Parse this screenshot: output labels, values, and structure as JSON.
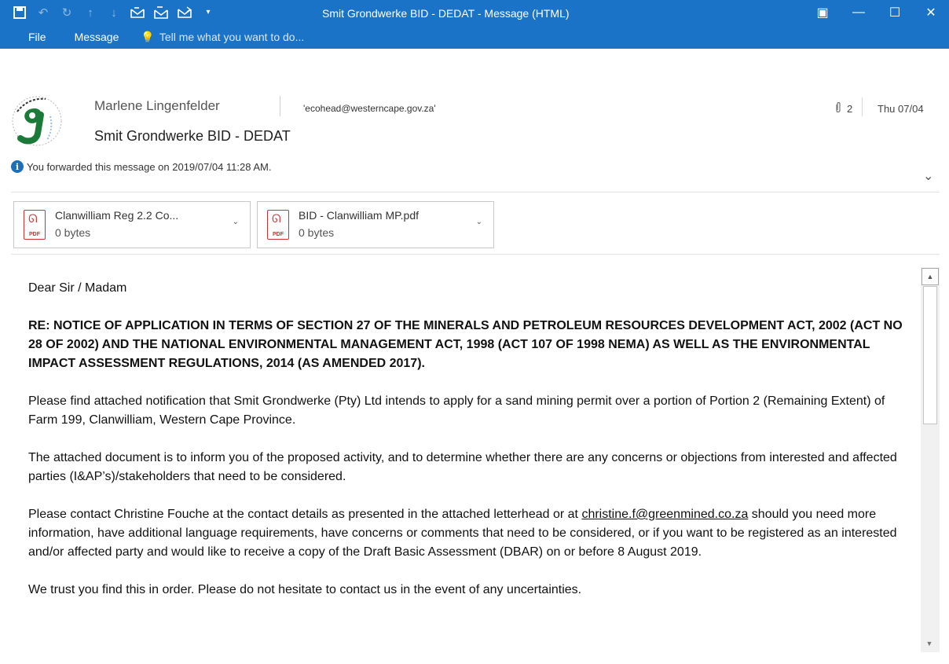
{
  "window": {
    "title": "Smit Grondwerke BID - DEDAT - Message (HTML)",
    "accent_color": "#1a73c6",
    "qat_icons": [
      "save-icon",
      "undo-icon",
      "redo-icon",
      "previous-item-icon",
      "next-item-icon",
      "reply-icon",
      "reply-all-icon",
      "forward-icon",
      "customize-qat-icon"
    ],
    "controls": {
      "ribbon_display": "▣",
      "minimize": "—",
      "maximize": "☐",
      "close": "✕"
    }
  },
  "ribbon": {
    "tabs": [
      "File",
      "Message"
    ],
    "tell_me": "Tell me what you want to do..."
  },
  "header": {
    "sender": "Marlene Lingenfelder",
    "to": "'ecohead@westerncape.gov.za'",
    "attachment_count": "2",
    "date": "Thu 07/04",
    "subject": "Smit Grondwerke BID - DEDAT",
    "info": "You forwarded this message on 2019/07/04 11:28 AM."
  },
  "attachments": [
    {
      "name": "Clanwilliam Reg 2.2 Co...",
      "size": "0 bytes",
      "type": "PDF"
    },
    {
      "name": "BID - Clanwilliam MP.pdf",
      "size": "0 bytes",
      "type": "PDF"
    }
  ],
  "body": {
    "greeting": "Dear Sir / Madam",
    "re_line": "RE: NOTICE OF APPLICATION IN TERMS OF SECTION 27 OF THE MINERALS AND PETROLEUM RESOURCES DEVELOPMENT ACT, 2002 (ACT NO 28 OF 2002) AND THE NATIONAL ENVIRONMENTAL MANAGEMENT ACT, 1998 (ACT 107 OF 1998 NEMA) AS WELL AS THE ENVIRONMENTAL IMPACT ASSESSMENT REGULATIONS, 2014 (AS AMENDED 2017).",
    "p1": "Please find attached notification that Smit Grondwerke (Pty) Ltd intends to apply for a sand mining permit over a portion of Portion 2 (Remaining Extent) of Farm 199, Clanwilliam, Western Cape Province.",
    "p2": "The attached document is to inform you of the proposed activity, and to determine whether there are any concerns or objections from interested and affected parties (I&AP’s)/stakeholders that need to be considered.",
    "p3_pre": "Please contact Christine Fouche at the contact details as presented in the attached letterhead or at ",
    "p3_link": "christine.f@greenmined.co.za",
    "p3_post": " should you need more information, have additional language requirements, have concerns or comments that need to be considered, or if you want to be registered as an interested and/or affected party and would like to receive a copy of the Draft Basic Assessment (DBAR) on or before 8 August 2019.",
    "p4": "We trust you find this in order. Please do not hesitate to contact us in the event of any uncertainties."
  }
}
